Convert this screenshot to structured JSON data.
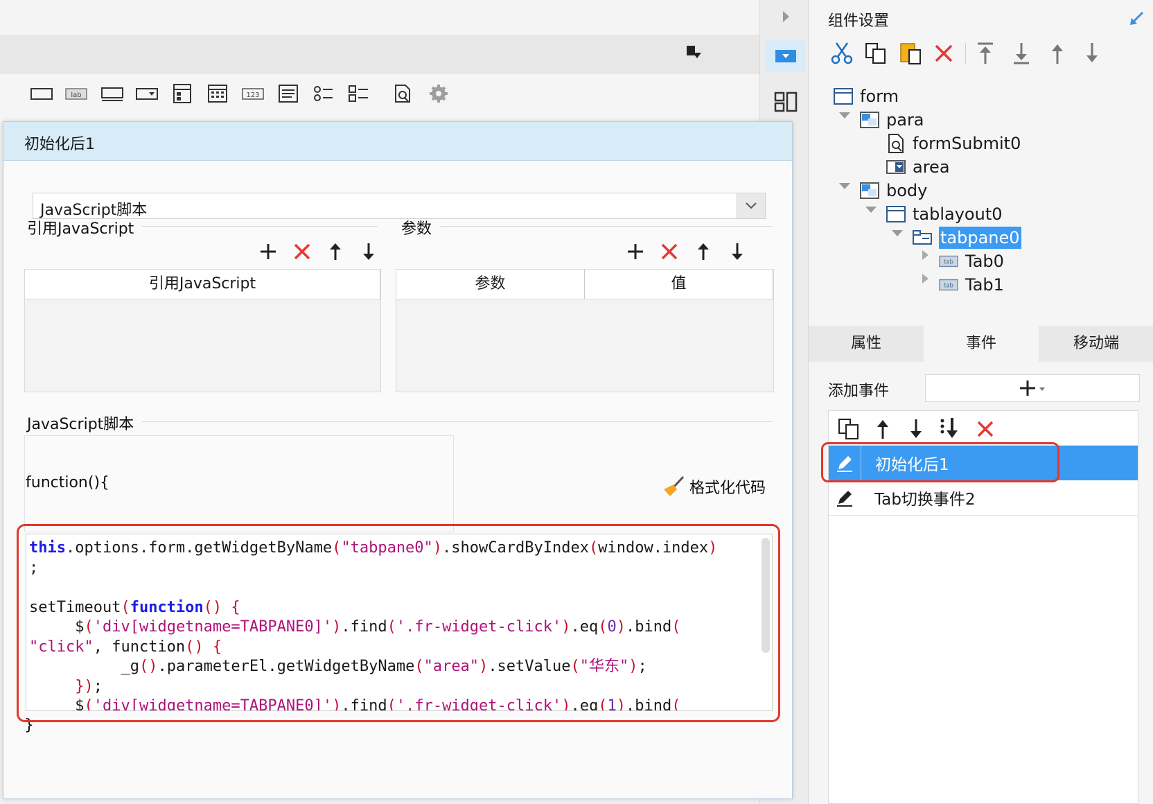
{
  "dialog": {
    "title": "初始化后1",
    "type_select": "JavaScript脚本",
    "ref_js_label": "引用JavaScript",
    "params_label": "参数",
    "ref_js_column": "引用JavaScript",
    "params_columns": [
      "参数",
      "值"
    ],
    "script_label": "JavaScript脚本",
    "function_header": "function(){",
    "format_code": "格式化代码",
    "closing_brace": "}"
  },
  "code_lines": [
    "this.options.form.getWidgetByName(\"tabpane0\").showCardByIndex(window.index)",
    ";",
    "",
    "setTimeout(function() {",
    "     $('div[widgetname=TABPANE0]').find('.fr-widget-click').eq(0).bind(",
    "\"click\", function() {",
    "          _g().parameterEl.getWidgetByName(\"area\").setValue(\"华东\");",
    "     });",
    "     $('div[widgetname=TABPANE0]').find('.fr-widget-click').eq(1).bind("
  ],
  "right_panel": {
    "title": "组件设置",
    "tree": [
      {
        "label": "form",
        "icon": "form-icon"
      },
      {
        "label": "para",
        "icon": "para-icon"
      },
      {
        "label": "formSubmit0",
        "icon": "submit-icon"
      },
      {
        "label": "area",
        "icon": "combo-icon"
      },
      {
        "label": "body",
        "icon": "body-icon"
      },
      {
        "label": "tablayout0",
        "icon": "layout-icon"
      },
      {
        "label": "tabpane0",
        "icon": "tabpane-icon"
      },
      {
        "label": "Tab0",
        "icon": "tab-icon"
      },
      {
        "label": "Tab1",
        "icon": "tab-icon"
      }
    ],
    "tabs": [
      "属性",
      "事件",
      "移动端"
    ],
    "add_event_label": "添加事件",
    "events": [
      "初始化后1",
      "Tab切换事件2"
    ]
  },
  "colors": {
    "accent": "#3d8fe0",
    "selection": "#3b9af1",
    "highlight_frame": "#e0382c",
    "delete_red": "#e53935"
  }
}
